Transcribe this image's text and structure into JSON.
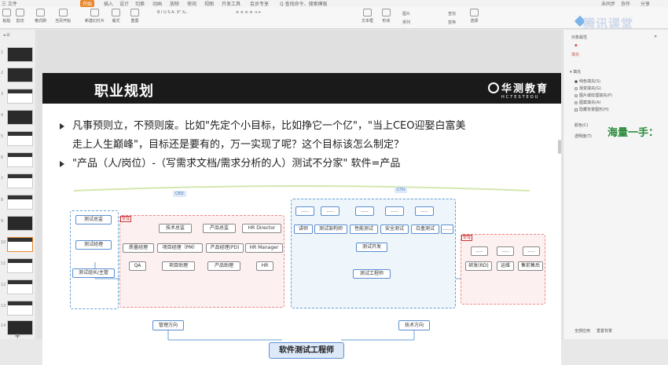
{
  "menubar": {
    "items": [
      "三 文件",
      "开始",
      "插入",
      "设计",
      "切换",
      "动画",
      "放映",
      "审阅",
      "视图",
      "开发工具",
      "会员专享",
      "Q 查找命令、搜索模板"
    ],
    "active": "开始",
    "right": [
      "未同步",
      "协作",
      "分享"
    ]
  },
  "ribbon": {
    "paste": "粘贴",
    "cut": "剪切",
    "copy": "复制",
    "format_painter": "格式刷",
    "from_start": "当页开始",
    "new_slide": "新建幻灯片",
    "layout": "版式",
    "section": "节",
    "reset": "重置",
    "textbox": "文本框",
    "shape": "形状",
    "picture": "图片",
    "arrange": "排列",
    "find": "查找",
    "replace": "替换",
    "select": "选择"
  },
  "thumbnails": {
    "numbers": [
      "1",
      "2",
      "3",
      "4",
      "5",
      "6",
      "7",
      "8",
      "9",
      "10",
      "11",
      "12",
      "13",
      "14"
    ],
    "selected": "10"
  },
  "slide": {
    "title": "职业规划",
    "logo_cn": "华测教育",
    "logo_en": "HCTESTEDU",
    "bullets": [
      "凡事预则立，不预则废。比如\"先定个小目标，比如挣它一个亿\"，\"当上CEO迎娶白富美",
      "走上人生巅峰\"，目标还是要有的，万一实现了呢？这个目标该怎么制定？",
      "\"产品（人/岗位）-（写需求文档/需求分析的人）测试不分家\"        软件=产品"
    ]
  },
  "orgchart": {
    "ceo": "CEO",
    "cto": "CTO",
    "mgmt_tag": "管理",
    "ops_tag": "管理",
    "test_column": [
      "测试总监",
      "测试经理",
      "测试组长/主管"
    ],
    "mgmt_top": [
      "技术总监",
      "产品总监",
      "HR Director"
    ],
    "mgmt_mid": [
      "质量经理",
      "项目经理（PM）",
      "产品经理(PD)",
      "HR Manager"
    ],
    "mgmt_bottom": [
      "QA",
      "项目助理",
      "产品助理",
      "HR"
    ],
    "tech_placeholders": [
      ".....",
      ".....",
      ".....",
      ".....",
      "....."
    ],
    "tech_roles": [
      "讲师",
      "测试架构师",
      "性能测试",
      "安全测试",
      "白盒测试",
      "......"
    ],
    "test_dev": "测试开发",
    "test_engineer": "测试工程师",
    "ops_placeholders": [
      ".....",
      ".....",
      "....."
    ],
    "ops_roles": [
      "研发(RD)",
      "运维",
      "售前售后"
    ],
    "mgmt_direction": "管理方向",
    "tech_direction": "技术方向",
    "root": "软件测试工程师"
  },
  "rightpanel": {
    "title": "对象属性",
    "tab": "填充",
    "section": "填充",
    "options": [
      "纯色填充(S)",
      "渐变填充(G)",
      "图片或纹理填充(P)",
      "图案填充(A)",
      "隐藏背景图形(H)"
    ],
    "color_label": "颜色(C)",
    "transparency_label": "透明度(T)",
    "apply_all": "全部应用",
    "reset_bg": "重置背景"
  },
  "watermark": "海量一手：",
  "brand": "腾讯课堂",
  "colors": {
    "accent": "#e8862a",
    "slide_header": "#1a1a1a",
    "blue": "#5b8fd0",
    "watermark": "#2a8a3a"
  }
}
